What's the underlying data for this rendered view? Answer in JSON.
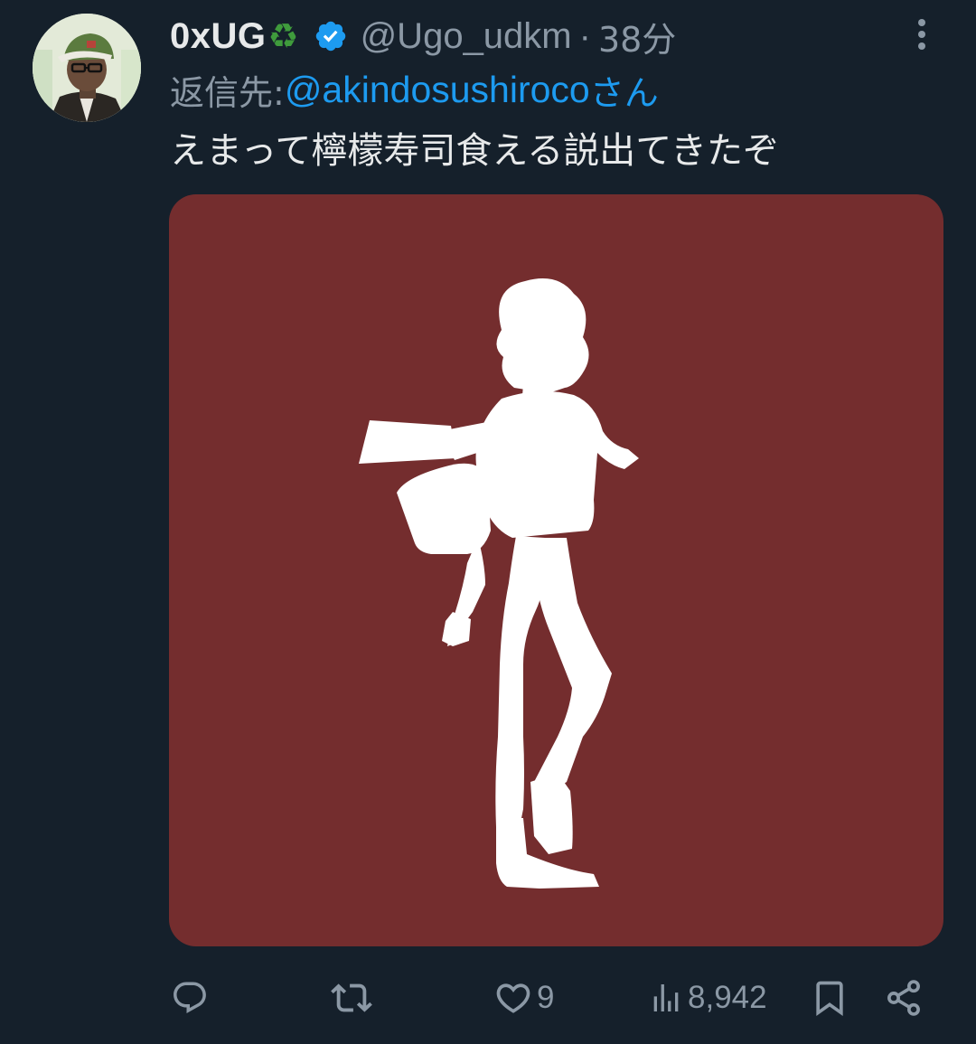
{
  "tweet": {
    "author": {
      "display_name": "0xUG",
      "name_emoji": "♻",
      "verified": true,
      "handle": "@Ugo_udkm",
      "separator": "·",
      "time": "38分",
      "avatar_icon": "avatar-image"
    },
    "reply_to": {
      "label": "返信先: ",
      "user": "@akindosushiroco",
      "suffix": "さん"
    },
    "text": "えまって檸檬寿司食える説出てきたぞ",
    "media": {
      "background_color": "#742d2e",
      "content": "white-silhouette-figure"
    },
    "actions": {
      "reply": {
        "icon": "reply-icon",
        "count": ""
      },
      "retweet": {
        "icon": "retweet-icon",
        "count": ""
      },
      "like": {
        "icon": "heart-icon",
        "count": "9"
      },
      "views": {
        "icon": "views-icon",
        "count": "8,942"
      },
      "bookmark": {
        "icon": "bookmark-icon"
      },
      "share": {
        "icon": "share-icon"
      }
    }
  },
  "colors": {
    "background": "#15202b",
    "text_primary": "#e7e9ea",
    "text_secondary": "#8b98a5",
    "link": "#1d9bf0",
    "verified": "#1d9bf0",
    "media_bg": "#742d2e"
  }
}
